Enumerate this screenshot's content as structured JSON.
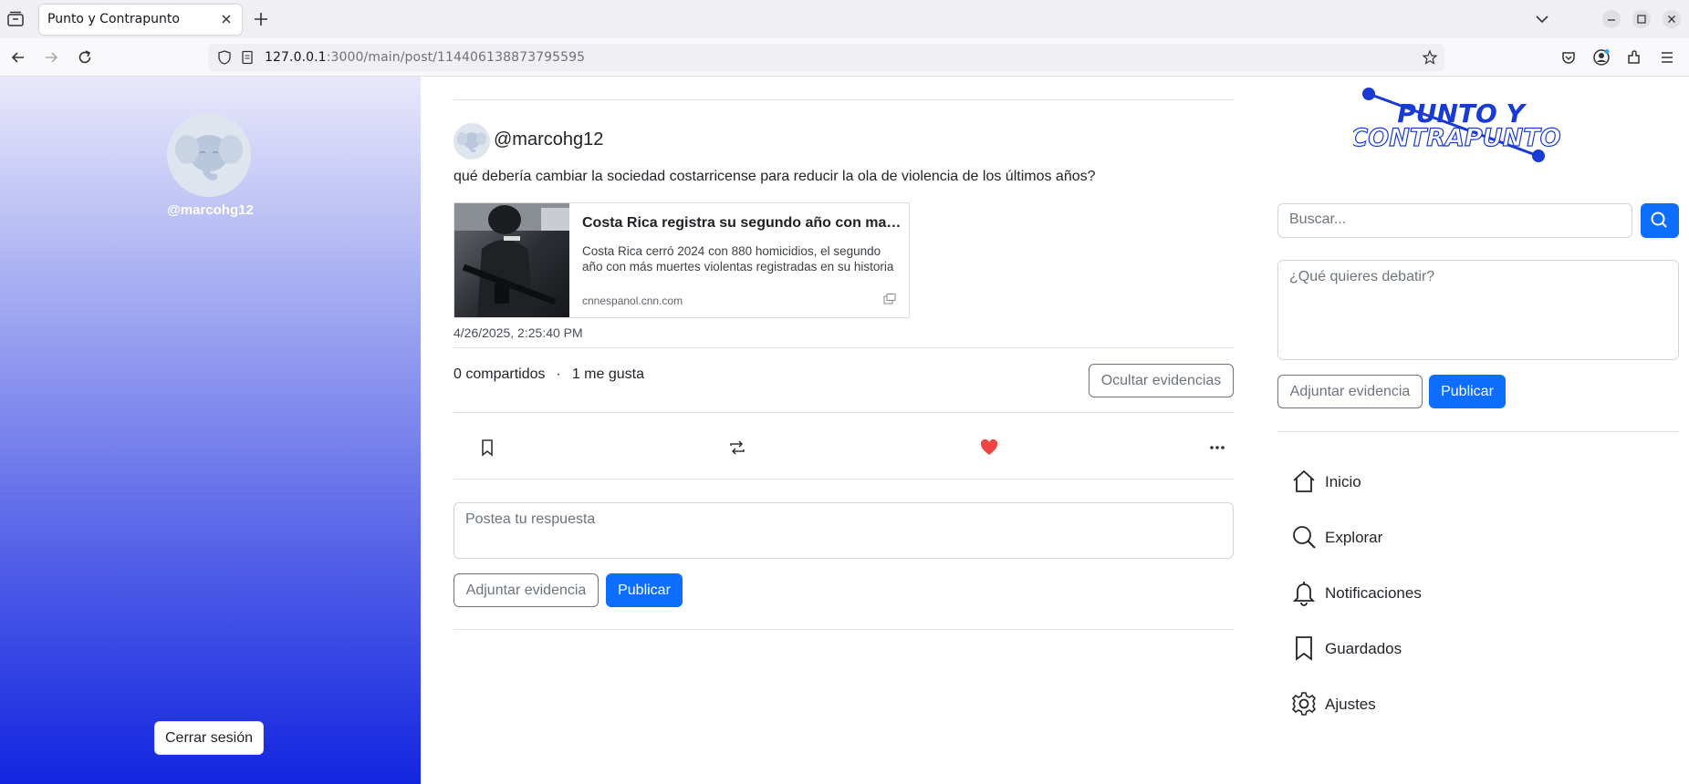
{
  "browser": {
    "tab_title": "Punto y Contrapunto",
    "url_host": "127.0.0.1",
    "url_rest": ":3000/main/post/114406138873795595"
  },
  "left": {
    "handle": "@marcohg12",
    "logout_label": "Cerrar sesión"
  },
  "post": {
    "handle": "@marcohg12",
    "text": "qué debería cambiar la sociedad costarricense para reducir la ola de violencia de los últimos años?",
    "link_card": {
      "title": "Costa Rica registra su segundo año con mayor número de homicidios",
      "description": "Costa Rica cerró 2024 con 880 homicidios, el segundo año con más muertes violentas registradas en su historia",
      "domain": "cnnespanol.cnn.com"
    },
    "date": "4/26/2025, 2:25:40 PM",
    "shares": "0 compartidos",
    "separator": "·",
    "likes": "1 me gusta",
    "hide_evidence_label": "Ocultar evidencias",
    "liked": true
  },
  "reply": {
    "placeholder": "Postea tu respuesta",
    "attach_label": "Adjuntar evidencia",
    "publish_label": "Publicar"
  },
  "right": {
    "logo_line1": "PUNTO Y",
    "logo_line2": "CONTRAPUNTO",
    "search_placeholder": "Buscar...",
    "debate_placeholder": "¿Qué quieres debatir?",
    "attach_label": "Adjuntar evidencia",
    "publish_label": "Publicar",
    "menu": [
      {
        "label": "Inicio",
        "icon": "home-icon"
      },
      {
        "label": "Explorar",
        "icon": "search-icon"
      },
      {
        "label": "Notificaciones",
        "icon": "bell-icon"
      },
      {
        "label": "Guardados",
        "icon": "bookmark-icon"
      },
      {
        "label": "Ajustes",
        "icon": "gear-icon"
      }
    ]
  },
  "colors": {
    "primary": "#0d6efd",
    "like": "#ef4444",
    "sidebar_top": "#e9e8fb",
    "sidebar_bottom": "#1226e0"
  }
}
